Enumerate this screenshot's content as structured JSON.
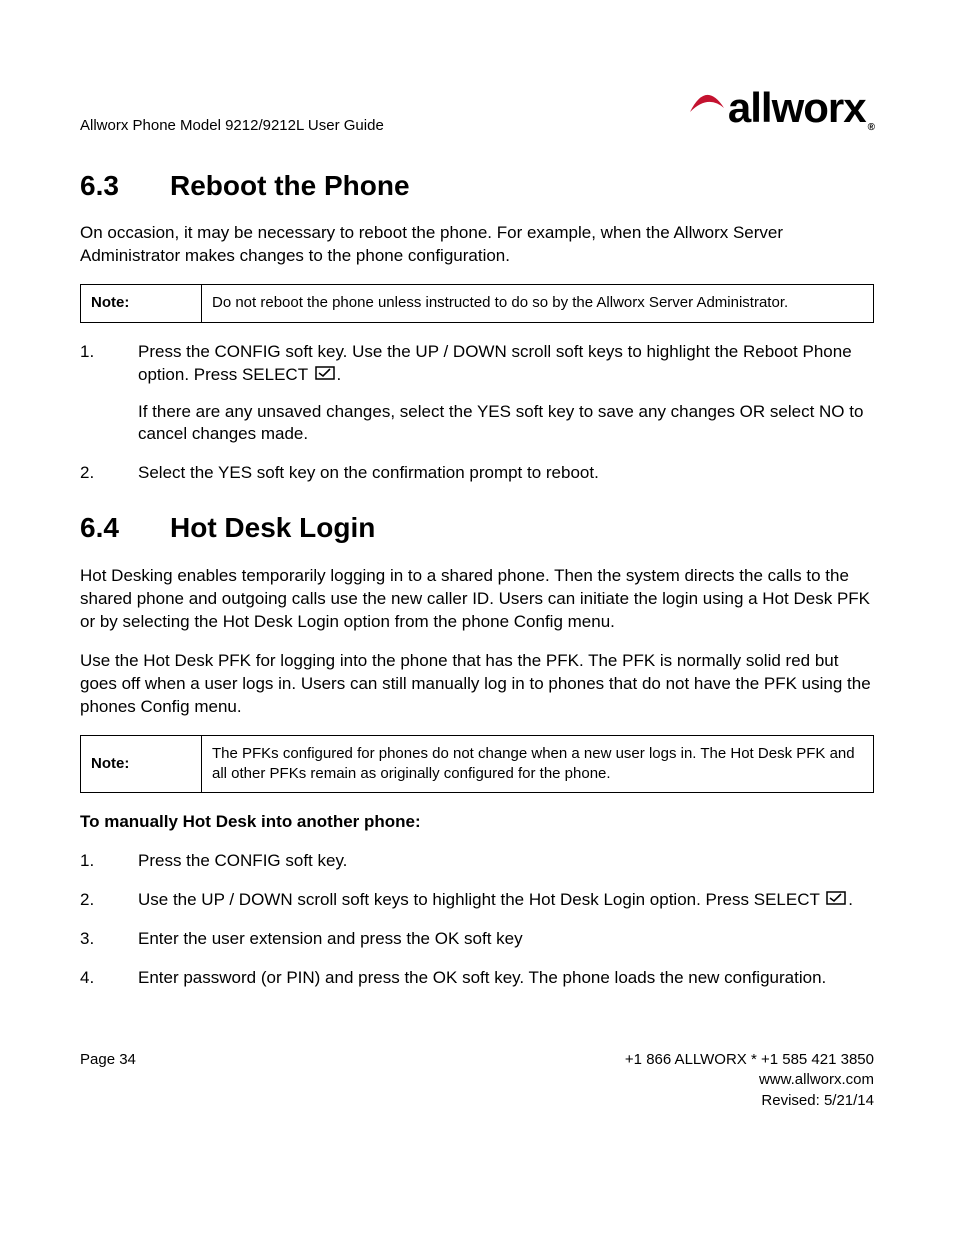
{
  "header": {
    "doc_title": "Allworx Phone Model 9212/9212L User Guide",
    "logo_text": "allworx",
    "logo_reg": "®"
  },
  "sections": {
    "s63": {
      "number": "6.3",
      "title": "Reboot the Phone",
      "intro": "On occasion, it may be necessary to reboot the phone. For example, when the Allworx Server Administrator makes changes to the phone configuration.",
      "note_label": "Note:",
      "note_text": "Do not reboot the phone unless instructed to do so by the Allworx Server Administrator.",
      "steps": {
        "s1a": "Press the CONFIG soft key. Use the UP / DOWN scroll soft keys to highlight the Reboot Phone option. Press SELECT ",
        "s1a_tail": ".",
        "s1b": "If there are any unsaved changes, select the YES soft key to save any changes OR select NO to cancel changes made.",
        "s2": "Select the YES soft key on the confirmation prompt to reboot."
      }
    },
    "s64": {
      "number": "6.4",
      "title": "Hot Desk Login",
      "p1": "Hot Desking enables temporarily logging in to a shared phone. Then the system directs the calls to the shared phone and outgoing calls use the new caller ID. Users can initiate the login using a Hot Desk PFK or by selecting the Hot Desk Login option from the phone Config menu.",
      "p2": "Use the Hot Desk PFK for logging into the phone that has the PFK. The PFK is normally solid red but goes off when a user logs in. Users can still manually log in to phones that do not have the PFK using the phones Config menu.",
      "note_label": "Note:",
      "note_text": "The PFKs configured for phones do not change when a new user logs in. The Hot Desk PFK and all other PFKs remain as originally configured for the phone.",
      "sub": "To manually Hot Desk into another phone:",
      "steps": {
        "s1": "Press the CONFIG soft key.",
        "s2a": "Use the UP / DOWN scroll soft keys to highlight the Hot Desk Login option. Press SELECT ",
        "s2a_tail": ".",
        "s3": "Enter the user extension and press the OK soft key",
        "s4": "Enter password (or PIN) and press the OK soft key. The phone loads the new configuration."
      }
    }
  },
  "footer": {
    "page": "Page 34",
    "phone": "+1 866 ALLWORX * +1 585 421 3850",
    "url": "www.allworx.com",
    "revised": "Revised: 5/21/14"
  }
}
